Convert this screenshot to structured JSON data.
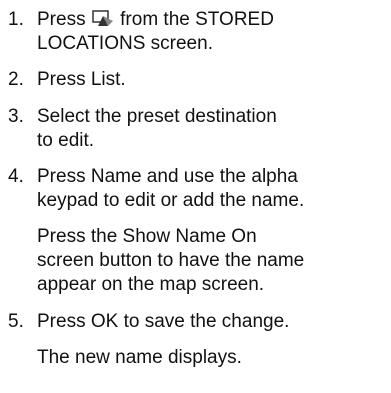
{
  "steps": [
    {
      "number": "1.",
      "before_icon": "Press",
      "icon": "map-view-icon",
      "after_icon": "from the STORED",
      "line2": "LOCATIONS screen."
    },
    {
      "number": "2.",
      "line1": "Press List."
    },
    {
      "number": "3.",
      "line1": "Select the preset destination",
      "line2": "to edit."
    },
    {
      "number": "4.",
      "line1": "Press Name and use the alpha",
      "line2": "keypad to edit or add the name.",
      "note_line1": "Press the Show Name On",
      "note_line2": "screen button to have the name",
      "note_line3": "appear on the map screen."
    },
    {
      "number": "5.",
      "line1": "Press OK to save the change.",
      "note_line1": "The new name displays."
    }
  ]
}
